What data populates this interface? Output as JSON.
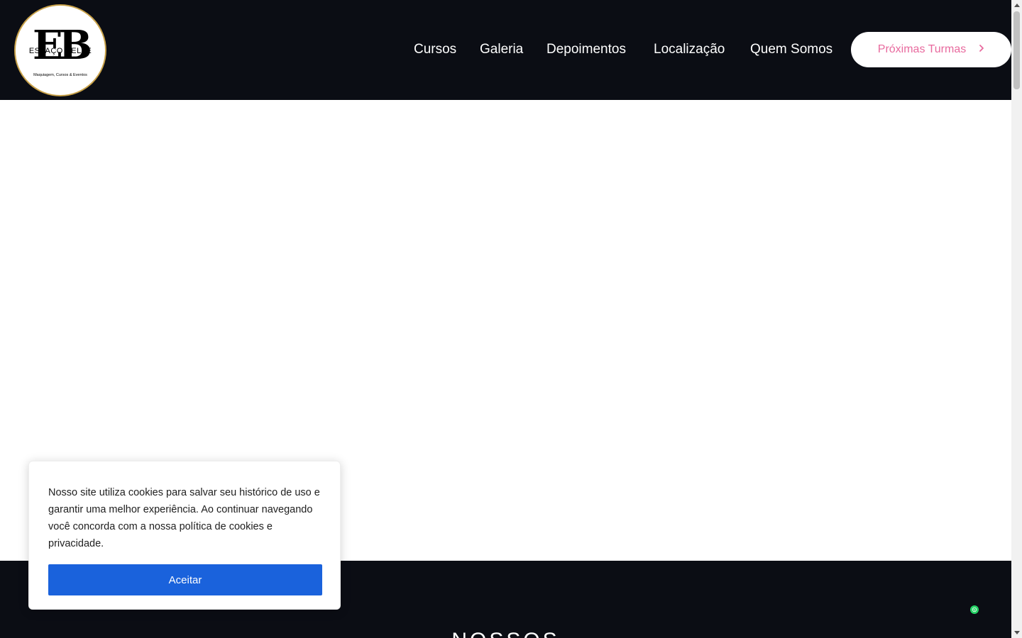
{
  "header": {
    "logo": {
      "mark": "EB",
      "name": "ESPAÇO BELLE",
      "tagline": "Maquiagem, Cursos & Eventos"
    },
    "nav": [
      {
        "label": "Cursos"
      },
      {
        "label": "Galeria"
      },
      {
        "label": "Depoimentos"
      },
      {
        "label": "Localização"
      },
      {
        "label": "Quem Somos"
      }
    ],
    "cta": {
      "label": "Próximas Turmas",
      "icon": "chevron-right-icon"
    }
  },
  "section": {
    "heading": "NOSSOS"
  },
  "cookie_banner": {
    "text": "Nosso site utiliza cookies para salvar seu histórico de uso e garantir uma melhor experiência. Ao continuar navegando você concorda com a nossa política de cookies e privacidade.",
    "accept_label": "Aceitar"
  },
  "floating": {
    "whatsapp_icon": "whatsapp-icon"
  },
  "colors": {
    "header_bg": "#0b0d14",
    "cta_text": "#e86a9e",
    "accept_button": "#1a62dc",
    "whatsapp": "#25d366",
    "logo_border": "#c9a24a"
  }
}
